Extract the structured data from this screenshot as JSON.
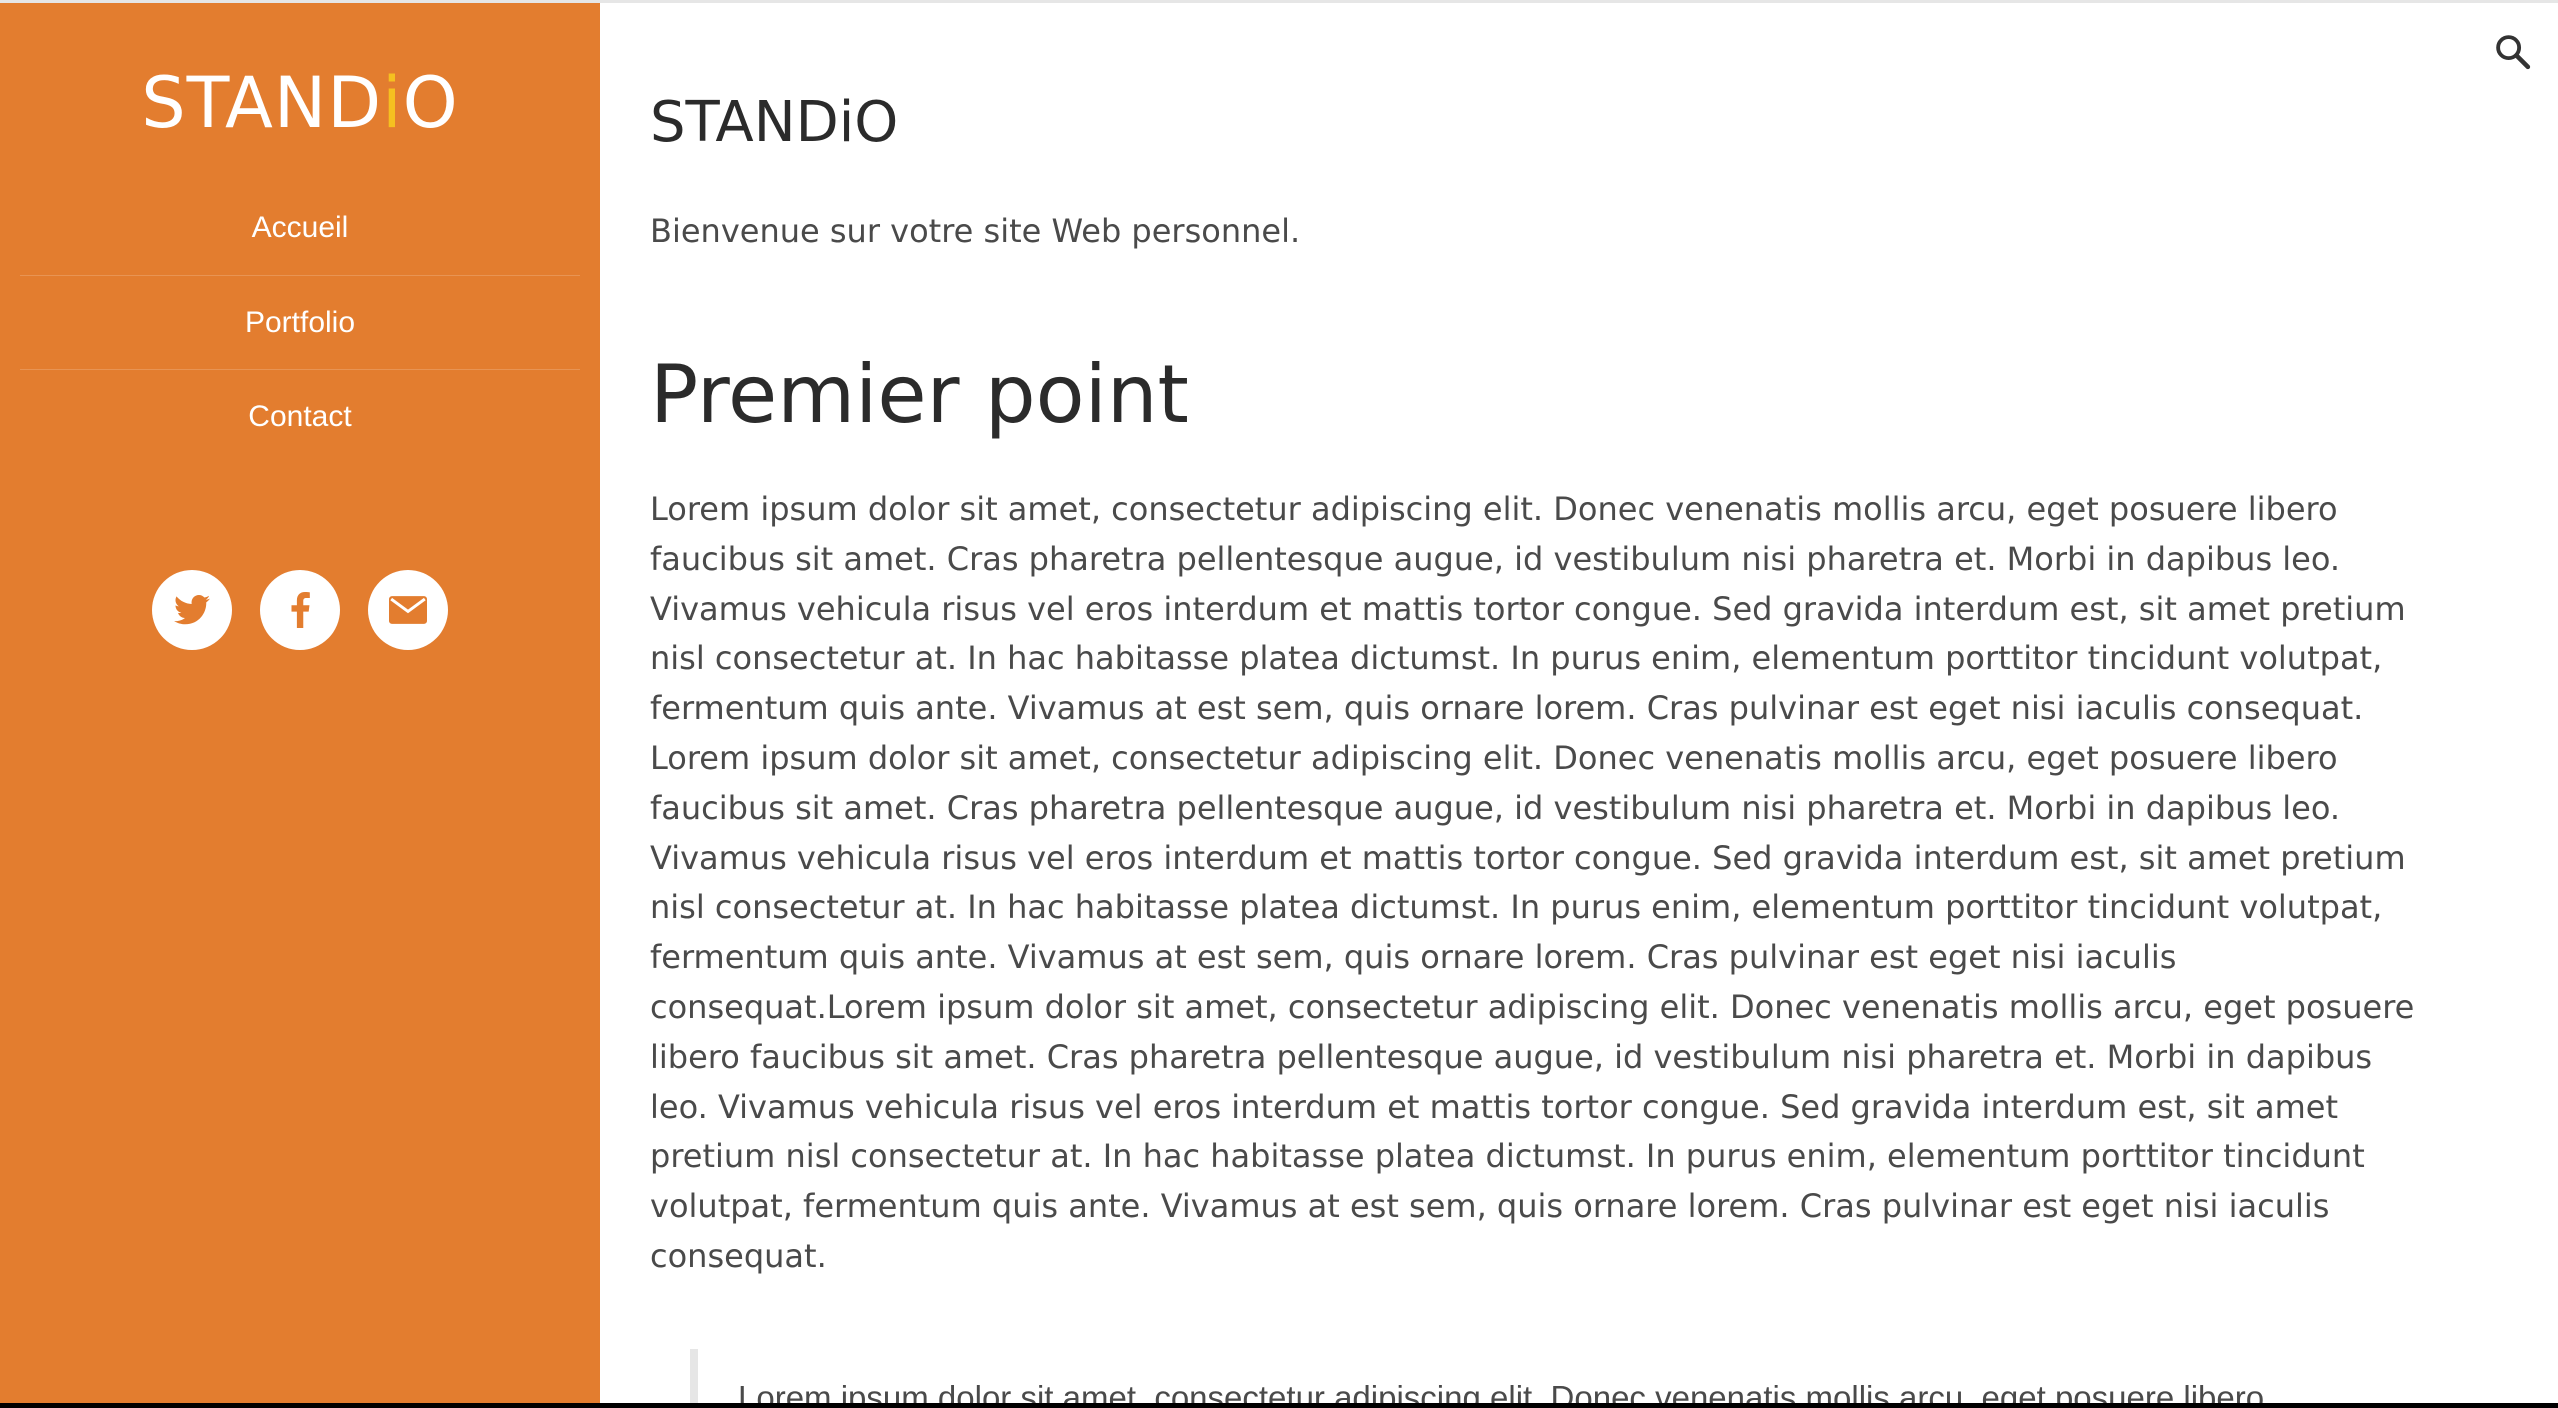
{
  "colors": {
    "sidebar_background": "#e37d2f",
    "logo_accent": "#f5c020",
    "text_dark": "#2b2b2b",
    "text_body": "#4a4a4a"
  },
  "sidebar": {
    "logo_prefix": "STAND",
    "logo_accent": "i",
    "logo_suffix": "O",
    "nav_items": [
      {
        "label": "Accueil"
      },
      {
        "label": "Portfolio"
      },
      {
        "label": "Contact"
      }
    ],
    "social": [
      {
        "icon": "twitter-icon"
      },
      {
        "icon": "facebook-icon"
      },
      {
        "icon": "mail-icon"
      }
    ]
  },
  "header": {
    "search_icon": "search-icon"
  },
  "main": {
    "site_title": "STANDiO",
    "subtitle": "Bienvenue sur votre site Web personnel.",
    "section_heading": "Premier point",
    "body_text": "Lorem ipsum dolor sit amet, consectetur adipiscing elit. Donec venenatis mollis arcu, eget posuere libero faucibus sit amet. Cras pharetra pellentesque augue, id vestibulum nisi pharetra et. Morbi in dapibus leo. Vivamus vehicula risus vel eros interdum et mattis tortor congue. Sed gravida interdum est, sit amet pretium nisl consectetur at. In hac habitasse platea dictumst. In purus enim, elementum porttitor tincidunt volutpat, fermentum quis ante. Vivamus at est sem, quis ornare lorem. Cras pulvinar est eget nisi iaculis consequat. Lorem ipsum dolor sit amet, consectetur adipiscing elit. Donec venenatis mollis arcu, eget posuere libero faucibus sit amet. Cras pharetra pellentesque augue, id vestibulum nisi pharetra et. Morbi in dapibus leo. Vivamus vehicula risus vel eros interdum et mattis tortor congue. Sed gravida interdum est, sit amet pretium nisl consectetur at. In hac habitasse platea dictumst. In purus enim, elementum porttitor tincidunt volutpat, fermentum quis ante. Vivamus at est sem, quis ornare lorem. Cras pulvinar est eget nisi iaculis consequat.Lorem ipsum dolor sit amet, consectetur adipiscing elit. Donec venenatis mollis arcu, eget posuere libero faucibus sit amet. Cras pharetra pellentesque augue, id vestibulum nisi pharetra et. Morbi in dapibus leo. Vivamus vehicula risus vel eros interdum et mattis tortor congue. Sed gravida interdum est, sit amet pretium nisl consectetur at. In hac habitasse platea dictumst. In purus enim, elementum porttitor tincidunt volutpat, fermentum quis ante. Vivamus at est sem, quis ornare lorem. Cras pulvinar est eget nisi iaculis consequat.",
    "blockquote_text": "Lorem ipsum dolor sit amet, consectetur adipiscing elit. Donec venenatis mollis arcu, eget posuere libero"
  }
}
